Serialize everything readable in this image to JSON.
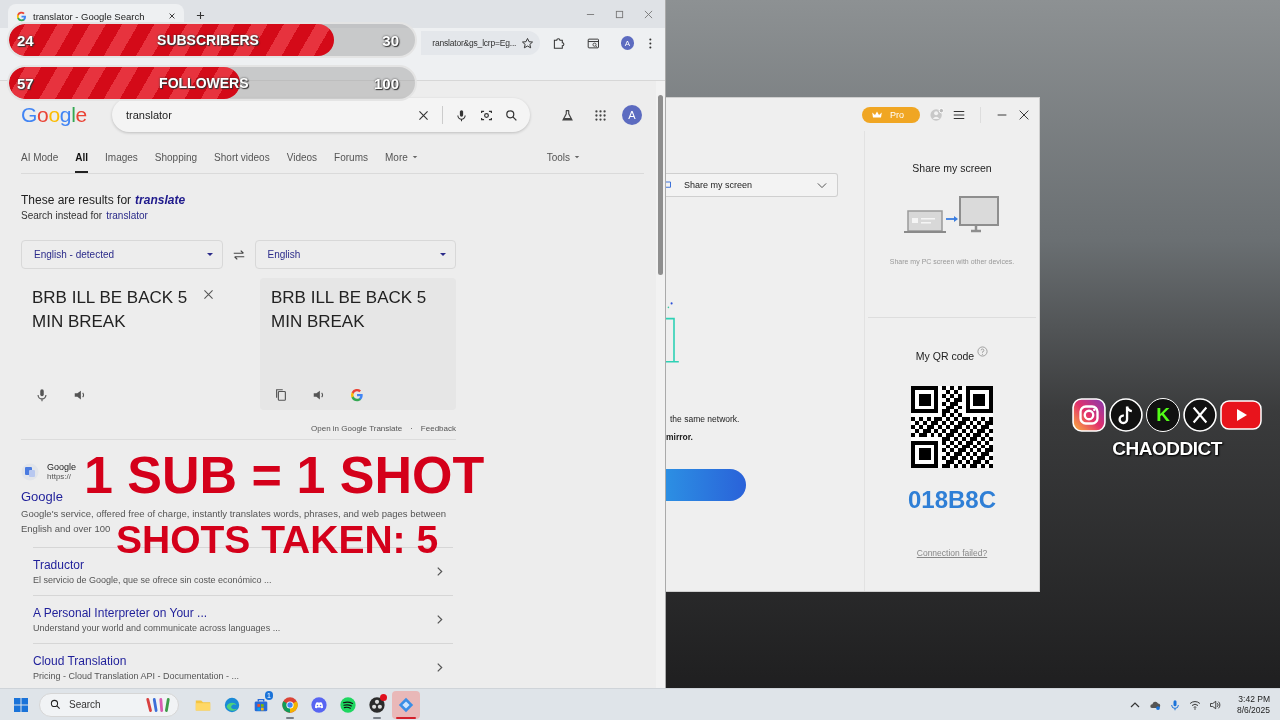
{
  "chrome": {
    "tab_title": "translator - Google Search",
    "address": "ranslator&gs_lcrp=Eg...",
    "profile_initial": "A"
  },
  "overlay": {
    "goals": [
      {
        "current": "24",
        "label": "SUBSCRIBERS",
        "target": "30",
        "level": 0.8
      },
      {
        "current": "57",
        "label": "FOLLOWERS",
        "target": "100",
        "level": 0.57
      }
    ],
    "headline": "1 SUB = 1 SHOT",
    "counter": "SHOTS TAKEN: 5",
    "socials": [
      {
        "kind": "instagram"
      },
      {
        "kind": "tiktok"
      },
      {
        "kind": "kick",
        "glyph": "K"
      },
      {
        "kind": "x"
      },
      {
        "kind": "youtube"
      }
    ],
    "handle": "CHAODDICT"
  },
  "google": {
    "logo": "Google",
    "query": "translator",
    "avatar_initial": "A",
    "tabs": [
      {
        "label": "AI Mode",
        "selected": false,
        "kind": "tab"
      },
      {
        "label": "All",
        "selected": true,
        "kind": "tab"
      },
      {
        "label": "Images",
        "selected": false,
        "kind": "tab"
      },
      {
        "label": "Shopping",
        "selected": false,
        "kind": "tab"
      },
      {
        "label": "Short videos",
        "selected": false,
        "kind": "tab"
      },
      {
        "label": "Videos",
        "selected": false,
        "kind": "tab"
      },
      {
        "label": "Forums",
        "selected": false,
        "kind": "tab"
      },
      {
        "label": "More",
        "selected": false,
        "kind": "menu"
      }
    ],
    "tools": "Tools",
    "correction": {
      "prefix": "These are results for",
      "corrected": "translate",
      "instead_prefix": "Search instead for",
      "original": "translator"
    },
    "translator": {
      "source_language": "English - detected",
      "target_language": "English",
      "source_text": "BRB ILL BE BACK 5 MIN BREAK",
      "target_text": "BRB ILL BE BACK 5 MIN BREAK",
      "open_link": "Open in Google Translate",
      "separator": "·",
      "feedback": "Feedback"
    },
    "result": {
      "site": "Google",
      "url": "https://",
      "title": "Google",
      "snippet": [
        "Google's service, offered free of charge, instantly translates words, phrases, and web pages between",
        "English and over 100"
      ],
      "sublinks": [
        {
          "title": "Traductor",
          "description": "El servicio de Google, que se ofrece sin coste económico ..."
        },
        {
          "title": "A Personal Interpreter on Your ...",
          "description": "Understand your world and communicate across languages ..."
        },
        {
          "title": "Cloud Translation",
          "description": "Pricing - Cloud Translation API - Documentation - ..."
        }
      ]
    }
  },
  "mirror_app": {
    "plan": "Pro",
    "picker": "Share my screen",
    "note_1": "the same network.",
    "note_2": "mirror.",
    "panel_title": "Share my screen",
    "panel_description": "Share my PC screen with other devices.",
    "qr_title": "My QR code",
    "code": "018B8C",
    "help_link": "Connection failed?"
  },
  "taskbar": {
    "search_placeholder": "Search",
    "apps": [
      {
        "kind": "files",
        "running": false,
        "selected": false,
        "alert": false
      },
      {
        "kind": "edge",
        "running": false,
        "selected": false,
        "alert": false
      },
      {
        "kind": "store",
        "running": false,
        "selected": false,
        "alert": false,
        "badge": "1"
      },
      {
        "kind": "chrome",
        "running": true,
        "selected": false,
        "alert": false
      },
      {
        "kind": "discord",
        "running": false,
        "selected": false,
        "alert": false
      },
      {
        "kind": "spotify",
        "running": false,
        "selected": false,
        "alert": false
      },
      {
        "kind": "obs",
        "running": true,
        "selected": false,
        "alert": true
      },
      {
        "kind": "mirror",
        "running": true,
        "selected": true,
        "alert": false
      }
    ],
    "time": "3:42 PM",
    "date": "8/6/2025"
  }
}
